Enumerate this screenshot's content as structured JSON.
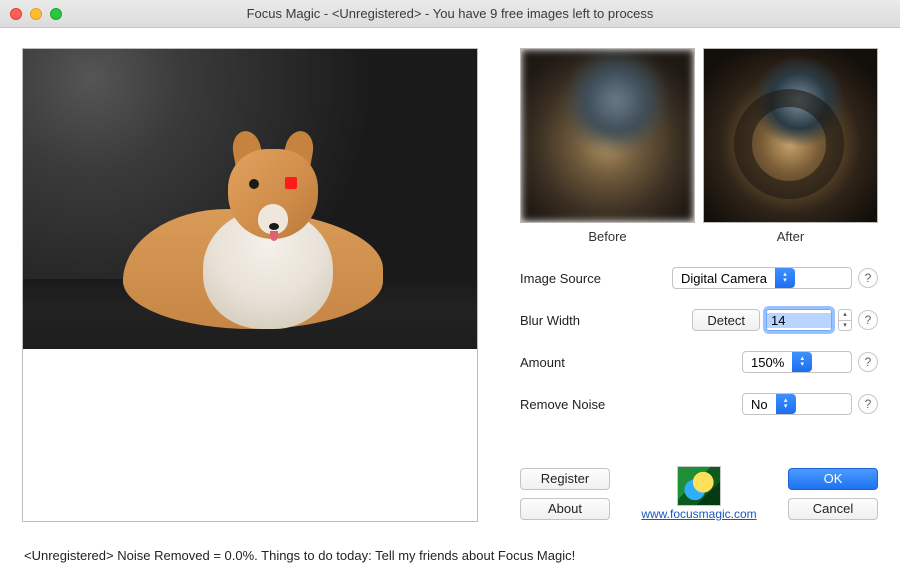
{
  "window": {
    "title": "Focus Magic - <Unregistered> - You have 9 free images left to process"
  },
  "previews": {
    "before_label": "Before",
    "after_label": "After"
  },
  "controls": {
    "image_source": {
      "label": "Image Source",
      "value": "Digital Camera"
    },
    "blur_width": {
      "label": "Blur Width",
      "detect_label": "Detect",
      "value": "14"
    },
    "amount": {
      "label": "Amount",
      "value": "150%"
    },
    "remove_noise": {
      "label": "Remove Noise",
      "value": "No"
    },
    "help_label": "?"
  },
  "footer": {
    "register_label": "Register",
    "about_label": "About",
    "ok_label": "OK",
    "cancel_label": "Cancel",
    "link_text": "www.focusmagic.com"
  },
  "status": "<Unregistered> Noise Removed = 0.0%. Things to do today: Tell my friends about Focus Magic!"
}
